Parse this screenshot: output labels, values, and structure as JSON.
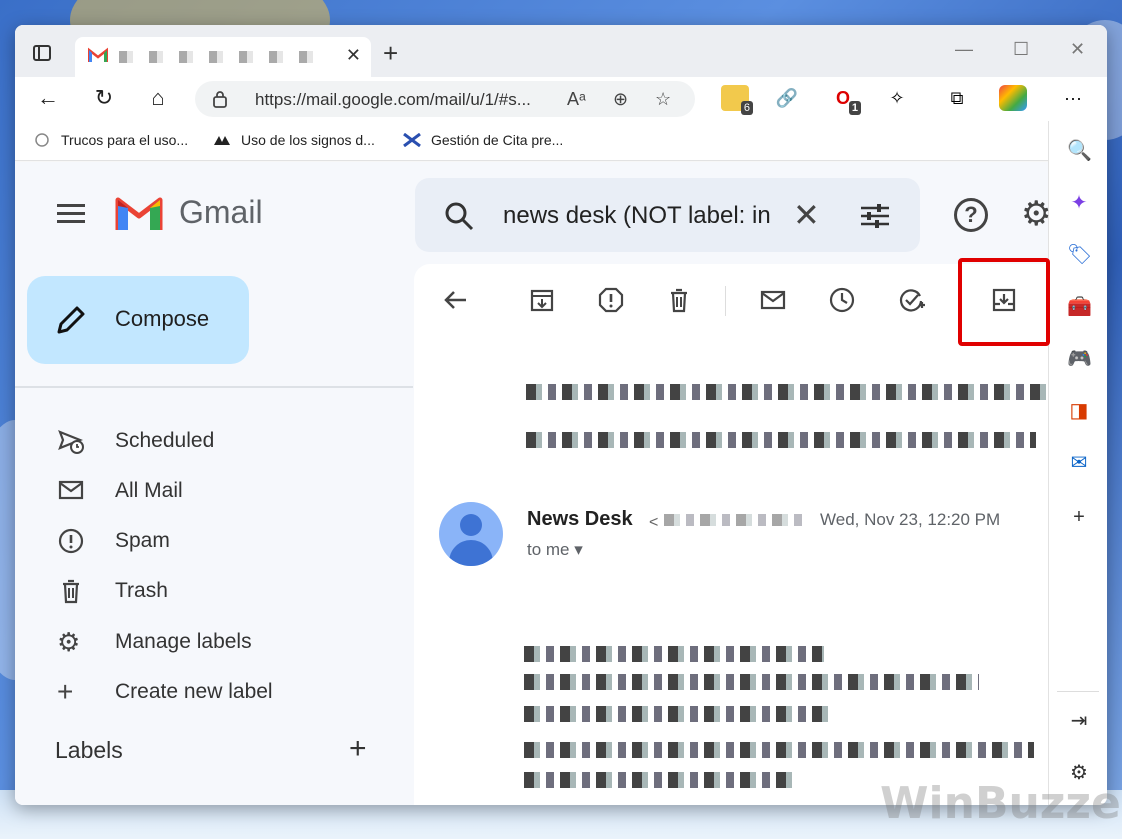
{
  "browser": {
    "tab": {
      "close_label": "✕"
    },
    "new_tab_label": "+",
    "window_controls": {
      "minimize": "—",
      "maximize": "☐",
      "close": "✕"
    },
    "address": {
      "url": "https://mail.google.com/mail/u/1/#s...",
      "read_aloud": "À̀",
      "zoom_icon": "zoom-in-icon",
      "favorite_icon": "add-favorite-icon"
    },
    "extensions": [
      {
        "name": "tampermonkey-ext",
        "badge": "6"
      },
      {
        "name": "link-ext",
        "badge": ""
      },
      {
        "name": "adblock-ext",
        "badge": "1"
      },
      {
        "name": "puzzle-ext",
        "badge": ""
      },
      {
        "name": "collections-ext",
        "badge": ""
      },
      {
        "name": "profile-ext",
        "badge": ""
      }
    ],
    "more_label": "···",
    "bookmarks": [
      {
        "label": "Trucos para el uso..."
      },
      {
        "label": "Uso de los signos d..."
      },
      {
        "label": "Gestión de Cita pre..."
      }
    ]
  },
  "gmail": {
    "brand": "Gmail",
    "search": {
      "query": "news desk (NOT label: in"
    },
    "help_label": "?",
    "compose_label": "Compose",
    "nav": [
      {
        "label": "Scheduled",
        "icon": "scheduled-send-icon"
      },
      {
        "label": "All Mail",
        "icon": "all-mail-icon"
      },
      {
        "label": "Spam",
        "icon": "spam-icon"
      },
      {
        "label": "Trash",
        "icon": "trash-icon"
      },
      {
        "label": "Manage labels",
        "icon": "gear-icon"
      },
      {
        "label": "Create new label",
        "icon": "plus-icon"
      }
    ],
    "labels_heading": "Labels",
    "message": {
      "sender": "News Desk",
      "sender_addr_prefix": "<",
      "date": "Wed, Nov 23, 12:20 PM",
      "recipient": "to me"
    }
  },
  "watermark": "WinBuzzer"
}
